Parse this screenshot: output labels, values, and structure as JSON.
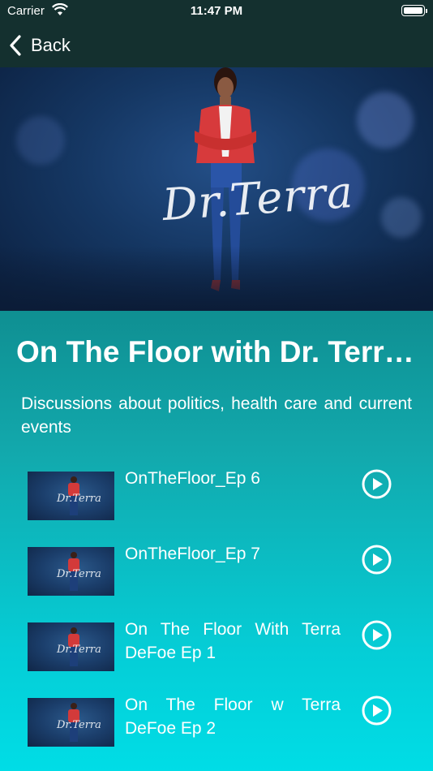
{
  "status_bar": {
    "carrier": "Carrier",
    "time": "11:47 PM"
  },
  "nav": {
    "back_label": "Back"
  },
  "hero": {
    "signature": "Dr.Terra"
  },
  "show": {
    "title": "On The Floor with Dr. Terra DeFoe",
    "description": "Discussions about politics, health care and current events"
  },
  "episodes": [
    {
      "title": "OnTheFloor_Ep 6"
    },
    {
      "title": "OnTheFloor_Ep 7"
    },
    {
      "title": "On The Floor With Terra DeFoe Ep 1"
    },
    {
      "title": "On The Floor w Terra DeFoe Ep 2"
    }
  ],
  "colors": {
    "nav_background": "#14302f",
    "gradient_top": "#0f8f92",
    "gradient_bottom": "#00dde6",
    "text": "#ffffff"
  }
}
